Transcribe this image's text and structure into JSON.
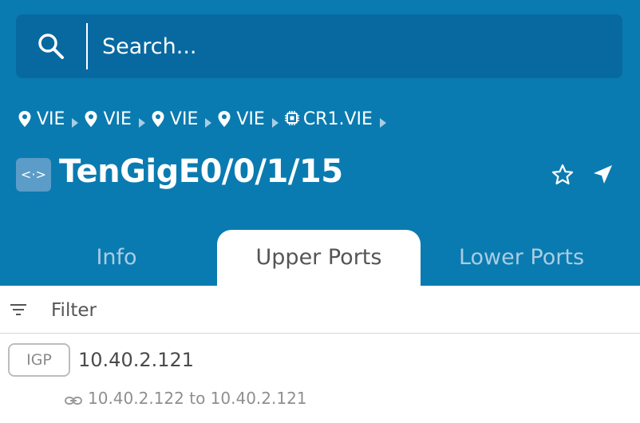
{
  "search": {
    "placeholder": "Search..."
  },
  "breadcrumb": [
    {
      "icon": "location-pin-icon",
      "label": "VIE"
    },
    {
      "icon": "location-pin-icon",
      "label": "VIE"
    },
    {
      "icon": "location-pin-icon",
      "label": "VIE"
    },
    {
      "icon": "location-pin-icon",
      "label": "VIE"
    },
    {
      "icon": "chip-icon",
      "label": "CR1.VIE"
    }
  ],
  "header": {
    "badge": "<·>",
    "title": "TenGigE0/0/1/15"
  },
  "tabs": [
    {
      "label": "Info",
      "active": false
    },
    {
      "label": "Upper Ports",
      "active": true
    },
    {
      "label": "Lower Ports",
      "active": false
    }
  ],
  "filter": {
    "placeholder": "Filter"
  },
  "items": [
    {
      "tag": "IGP",
      "title": "10.40.2.121",
      "subtitle": "10.40.2.122 to 10.40.2.121"
    }
  ],
  "colors": {
    "header_bg": "#0a7bb0",
    "search_bg": "#0869a0",
    "inactive_tab": "#a9cde3",
    "badge_bg": "#5b9cc8"
  }
}
